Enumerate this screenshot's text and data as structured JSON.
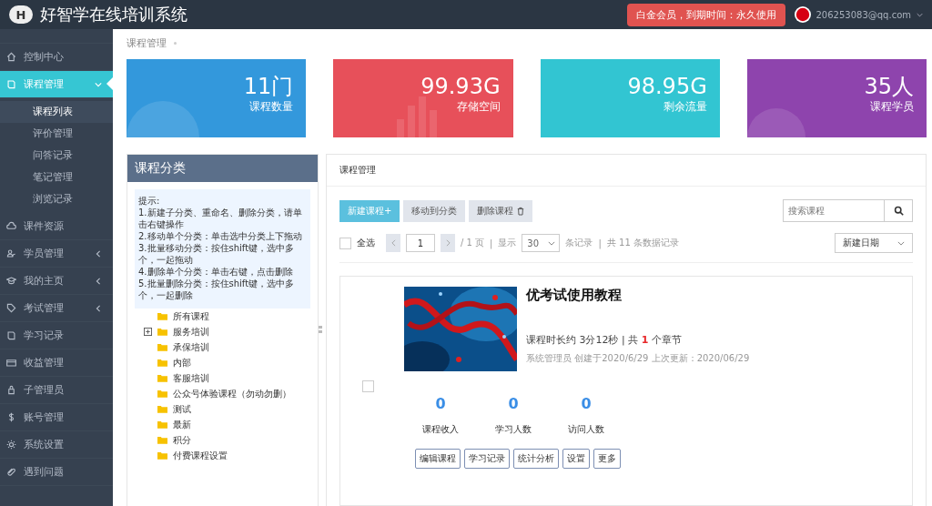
{
  "app": {
    "title": "好智学在线培训系统",
    "logo_letter": "H"
  },
  "membership": "白金会员，到期时间：永久使用",
  "user": {
    "email": "206253083@qq.com"
  },
  "sidebar": {
    "items": [
      {
        "label": "控制中心",
        "selected": false,
        "caret": false
      },
      {
        "label": "课程管理",
        "selected": true,
        "caret": true,
        "expanded": true,
        "children": [
          {
            "label": "课程列表",
            "selected": true
          },
          {
            "label": "评价管理",
            "selected": false
          },
          {
            "label": "问答记录",
            "selected": false
          },
          {
            "label": "笔记管理",
            "selected": false
          },
          {
            "label": "浏览记录",
            "selected": false
          }
        ]
      },
      {
        "label": "课件资源",
        "selected": false,
        "caret": false
      },
      {
        "label": "学员管理",
        "selected": false,
        "caret": true,
        "expanded": false
      },
      {
        "label": "我的主页",
        "selected": false,
        "caret": true,
        "expanded": false
      },
      {
        "label": "考试管理",
        "selected": false,
        "caret": true,
        "expanded": false
      },
      {
        "label": "学习记录",
        "selected": false,
        "caret": false
      },
      {
        "label": "收益管理",
        "selected": false,
        "caret": false
      },
      {
        "label": "子管理员",
        "selected": false,
        "caret": false
      },
      {
        "label": "账号管理",
        "selected": false,
        "caret": false
      },
      {
        "label": "系统设置",
        "selected": false,
        "caret": false
      },
      {
        "label": "遇到问题",
        "selected": false,
        "caret": false
      }
    ]
  },
  "breadcrumb": "课程管理",
  "stats": [
    {
      "value": "11门",
      "label": "课程数量",
      "color": "#3398dc"
    },
    {
      "value": "99.93G",
      "label": "存储空间",
      "color": "#e7505a"
    },
    {
      "value": "98.95G",
      "label": "剩余流量",
      "color": "#32c5d2"
    },
    {
      "value": "35人",
      "label": "课程学员",
      "color": "#8e44ad"
    }
  ],
  "category_panel": {
    "title": "课程分类",
    "hint": [
      "提示:",
      "1.新建子分类、重命名、删除分类，请单击右键操作",
      "2.移动单个分类：单击选中分类上下拖动",
      "3.批量移动分类：按住shift键，选中多个，一起拖动",
      "4.删除单个分类：单击右键，点击删除",
      "5.批量删除分类：按住shift键，选中多个，一起删除"
    ],
    "tree": [
      {
        "label": "所有课程",
        "expandable": false
      },
      {
        "label": "服务培训",
        "expandable": true
      },
      {
        "label": "承保培训",
        "expandable": false
      },
      {
        "label": "内部",
        "expandable": false
      },
      {
        "label": "客服培训",
        "expandable": false
      },
      {
        "label": "公众号体验课程（勿动勿删）",
        "expandable": false
      },
      {
        "label": "测试",
        "expandable": false
      },
      {
        "label": "最新",
        "expandable": false
      },
      {
        "label": "积分",
        "expandable": false
      },
      {
        "label": "付费课程设置",
        "expandable": false
      }
    ]
  },
  "course_panel": {
    "title": "课程管理",
    "actions": [
      {
        "label": "新建课程+",
        "kind": "primary"
      },
      {
        "label": "移动到分类",
        "kind": "plain"
      },
      {
        "label": "删除课程",
        "kind": "delete"
      }
    ],
    "search": {
      "placeholder": "搜索课程"
    },
    "select_all": {
      "label": "全选",
      "checked": false
    },
    "page": "1",
    "page_total": "/ 1 页",
    "separator": "|",
    "show_label": "显示",
    "page_size": "30",
    "records_label": "条记录",
    "total": "共 11 条数据记录",
    "sort": "新建日期",
    "courses": [
      {
        "title": "优考试使用教程",
        "duration_prefix": "课程时长约 3分12秒 | 共",
        "chapters": "1",
        "duration_suffix": "个章节",
        "meta": "系统管理员 创建于2020/6/29 上次更新：2020/06/29",
        "checked": false,
        "metrics": [
          {
            "value": "0",
            "label": "课程收入"
          },
          {
            "value": "0",
            "label": "学习人数"
          },
          {
            "value": "0",
            "label": "访问人数"
          }
        ],
        "buttons": [
          "编辑课程",
          "学习记录",
          "统计分析",
          "设置",
          "更多"
        ]
      }
    ]
  }
}
